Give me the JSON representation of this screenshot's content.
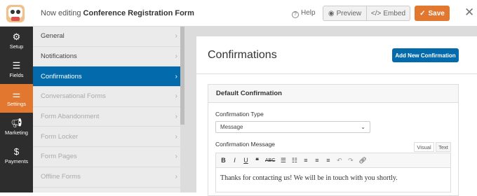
{
  "header": {
    "editing_prefix": "Now editing",
    "form_name": "Conference Registration Form",
    "help_label": "Help",
    "preview_label": "Preview",
    "embed_label": "Embed",
    "save_label": "Save"
  },
  "leftnav": {
    "items": [
      {
        "label": "Setup",
        "icon": "gear-icon"
      },
      {
        "label": "Fields",
        "icon": "fields-icon"
      },
      {
        "label": "Settings",
        "icon": "sliders-icon",
        "active": true
      },
      {
        "label": "Marketing",
        "icon": "megaphone-icon"
      },
      {
        "label": "Payments",
        "icon": "dollar-icon"
      }
    ]
  },
  "subnav": {
    "items": [
      {
        "label": "General"
      },
      {
        "label": "Notifications"
      },
      {
        "label": "Confirmations"
      },
      {
        "label": "Conversational Forms"
      },
      {
        "label": "Form Abandonment"
      },
      {
        "label": "Form Locker"
      },
      {
        "label": "Form Pages"
      },
      {
        "label": "Offline Forms"
      }
    ]
  },
  "main": {
    "title": "Confirmations",
    "add_button": "Add New Confirmation",
    "box_title": "Default Confirmation",
    "type_label": "Confirmation Type",
    "type_value": "Message",
    "message_label": "Confirmation Message",
    "tab_visual": "Visual",
    "tab_text": "Text",
    "message_text": "Thanks for contacting us! We will be in touch with you shortly."
  },
  "colors": {
    "accent": "#e27730",
    "primary": "#036aab",
    "sidebar": "#2d2d2d"
  }
}
